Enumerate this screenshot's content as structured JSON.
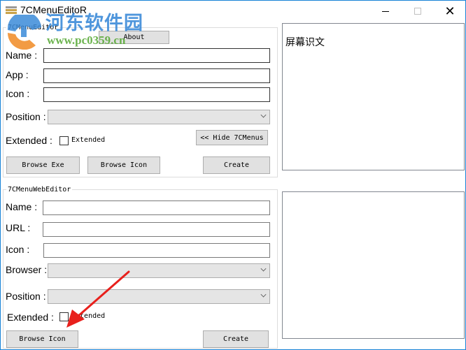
{
  "window": {
    "title": "7CMenuEditoR",
    "controls": {
      "minimize": "minimize",
      "maximize": "maximize",
      "close": "✕"
    }
  },
  "watermark": {
    "text_cn": "河东软件园",
    "url": "www.pc0359.cn"
  },
  "menu_editor": {
    "legend": "7CMenuEditor",
    "about_label": "About",
    "name_label": "Name :",
    "name_value": "",
    "app_label": "App :",
    "app_value": "",
    "icon_label": "Icon :",
    "icon_value": "",
    "position_label": "Position :",
    "position_value": "",
    "extended_label": "Extended :",
    "extended_checkbox_label": "Extended",
    "extended_checked": false,
    "hide_label": "<< Hide 7CMenus",
    "browse_exe_label": "Browse Exe",
    "browse_icon_label": "Browse Icon",
    "create_label": "Create"
  },
  "web_editor": {
    "legend": "7CMenuWebEditor",
    "name_label": "Name :",
    "name_value": "",
    "url_label": "URL :",
    "url_value": "",
    "icon_label": "Icon :",
    "icon_value": "",
    "browser_label": "Browser :",
    "browser_value": "",
    "position_label": "Position :",
    "position_value": "",
    "extended_label": "Extended :",
    "extended_checkbox_label": "Extended",
    "extended_checked": false,
    "browse_icon_label": "Browse Icon",
    "create_label": "Create"
  },
  "preview": {
    "top_text": "屏幕识文",
    "bottom_text": ""
  },
  "annotation": {
    "arrow_color": "#e8201c"
  }
}
